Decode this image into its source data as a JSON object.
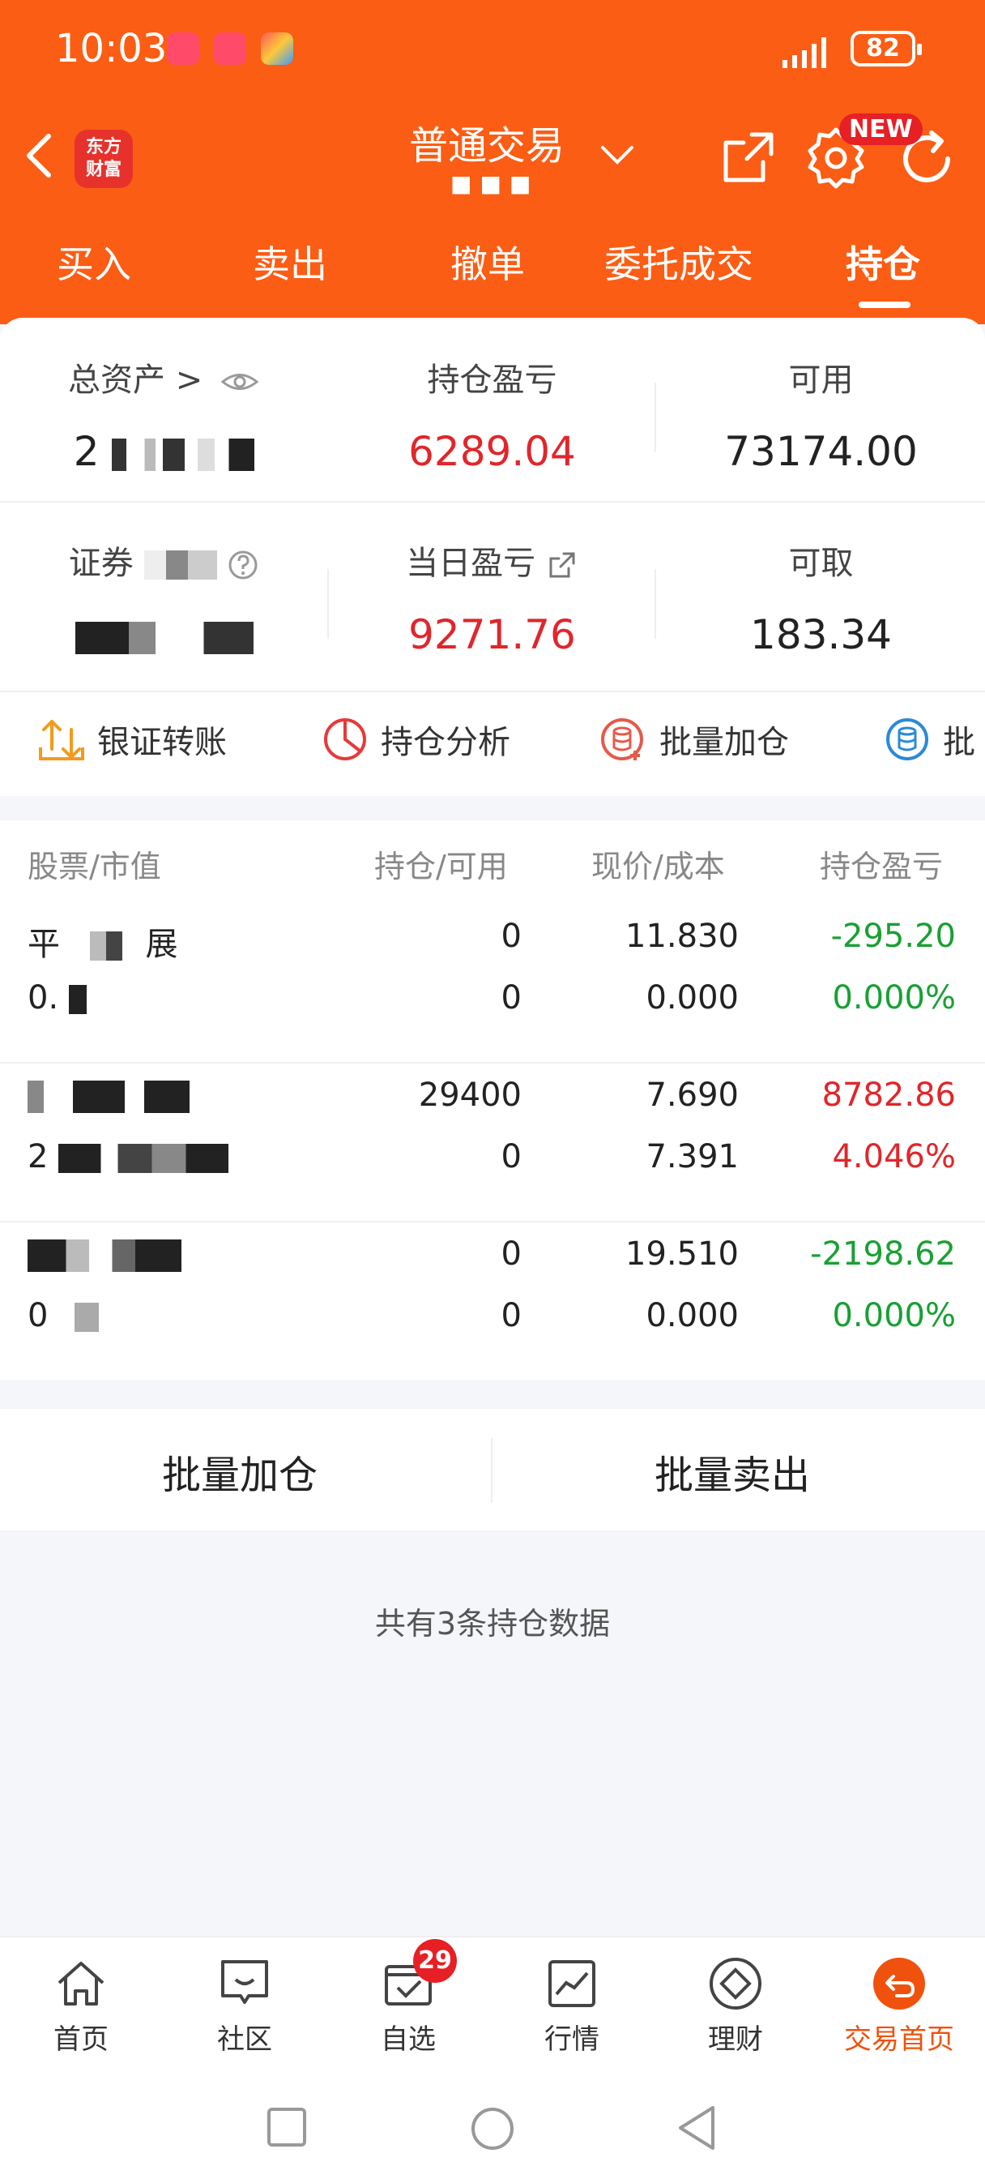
{
  "status_bar": {
    "time": "10:03",
    "battery": "82"
  },
  "nav": {
    "logo_line1": "东方",
    "logo_line2": "财富",
    "title": "普通交易",
    "subtitle": "■■■",
    "new_badge": "NEW"
  },
  "tabs": [
    "买入",
    "卖出",
    "撤单",
    "委托成交",
    "持仓"
  ],
  "summary": {
    "total_assets_label": "总资产 >",
    "total_assets_value": "2",
    "position_pnl_label": "持仓盈亏",
    "position_pnl_value": "6289.04",
    "available_label": "可用",
    "available_value": "73174.00",
    "securities_label": "证券",
    "securities_value": "",
    "daily_pnl_label": "当日盈亏",
    "daily_pnl_value": "9271.76",
    "withdrawable_label": "可取",
    "withdrawable_value": "183.34"
  },
  "actions": [
    "银证转账",
    "持仓分析",
    "批量加仓",
    "批"
  ],
  "table": {
    "headers": [
      "股票/市值",
      "持仓/可用",
      "现价/成本",
      "持仓盈亏"
    ],
    "rows": [
      {
        "name": "平",
        "name2": "展",
        "mv": "0.",
        "pos": "0",
        "avail": "0",
        "price": "11.830",
        "cost": "0.000",
        "pnl": "-295.20",
        "pct": "0.000%",
        "pnl_color": "green",
        "pct_color": "green"
      },
      {
        "name": "",
        "name2": "",
        "mv": "2",
        "pos": "29400",
        "avail": "0",
        "price": "7.690",
        "cost": "7.391",
        "pnl": "8782.86",
        "pct": "4.046%",
        "pnl_color": "red",
        "pct_color": "red"
      },
      {
        "name": "",
        "name2": "",
        "mv": "0",
        "pos": "0",
        "avail": "0",
        "price": "19.510",
        "cost": "0.000",
        "pnl": "-2198.62",
        "pct": "0.000%",
        "pnl_color": "green",
        "pct_color": "green"
      }
    ]
  },
  "batch": {
    "add": "批量加仓",
    "sell": "批量卖出"
  },
  "note": "共有3条持仓数据",
  "bottom_nav": [
    {
      "label": "首页",
      "icon": "home-icon"
    },
    {
      "label": "社区",
      "icon": "chat-icon"
    },
    {
      "label": "自选",
      "icon": "watchlist-icon"
    },
    {
      "label": "行情",
      "icon": "chart-icon"
    },
    {
      "label": "理财",
      "icon": "diamond-icon"
    },
    {
      "label": "交易首页",
      "icon": "trade-home-icon"
    }
  ],
  "watchlist_badge": "29",
  "colors": {
    "brand": "#fb5d14",
    "up": "#e0262b",
    "down": "#19a033"
  }
}
